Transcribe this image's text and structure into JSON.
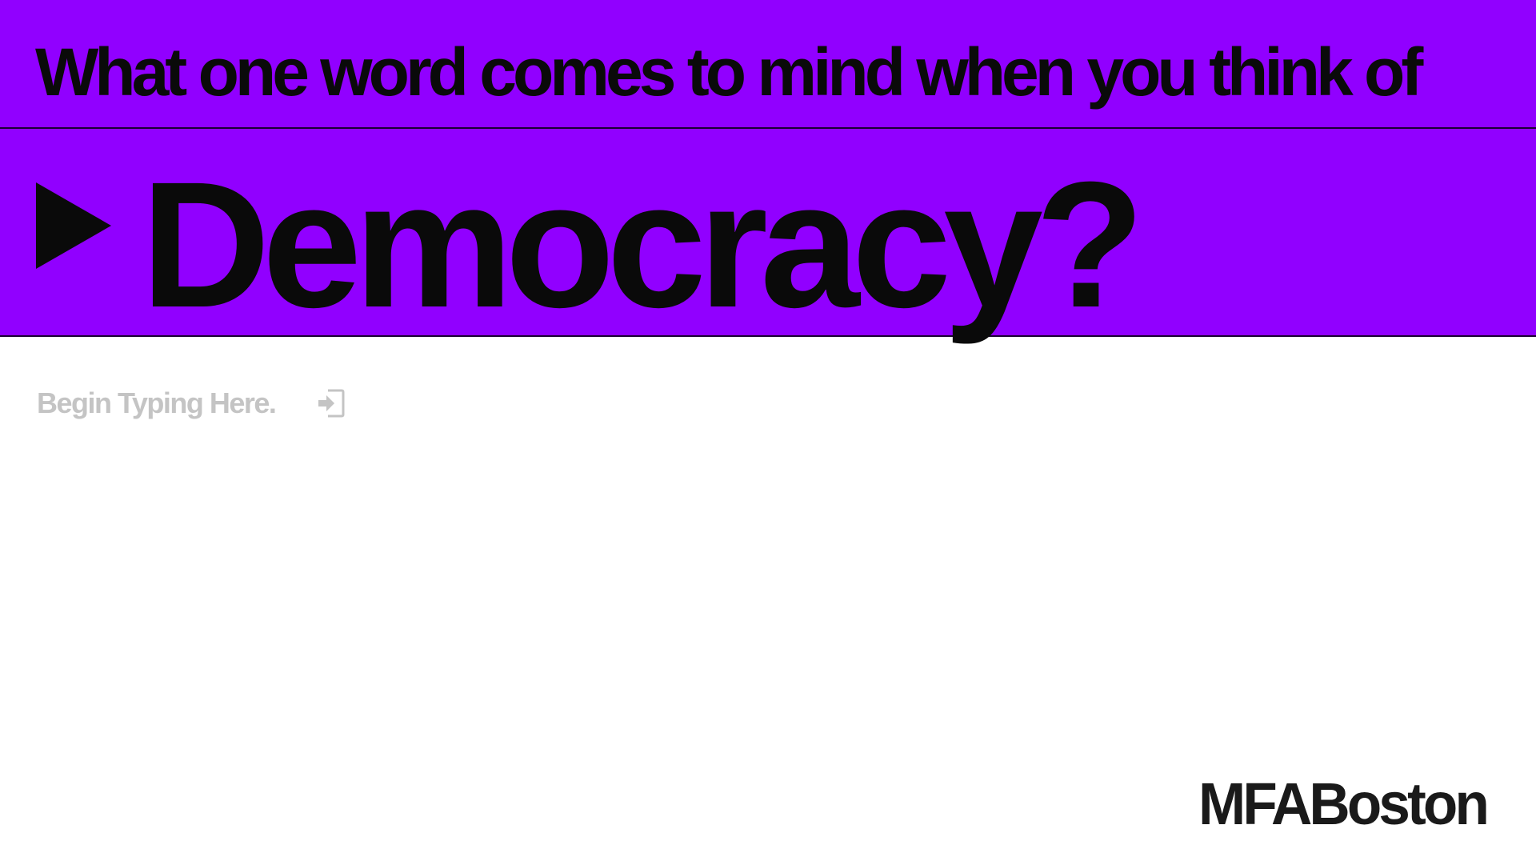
{
  "prompt": {
    "question": "What one word comes to mind when you think of",
    "keyword": "Democracy?"
  },
  "answer": {
    "placeholder": "Begin Typing Here.",
    "value": ""
  },
  "brand": {
    "logo_text": "MFABoston"
  },
  "icons": {
    "prompt_marker": "play-triangle-icon",
    "submit": "enter-arrow-icon"
  },
  "colors": {
    "band": "#9100ff",
    "text": "#0a0a0a",
    "placeholder": "#c4c4c4",
    "background": "#ffffff"
  }
}
